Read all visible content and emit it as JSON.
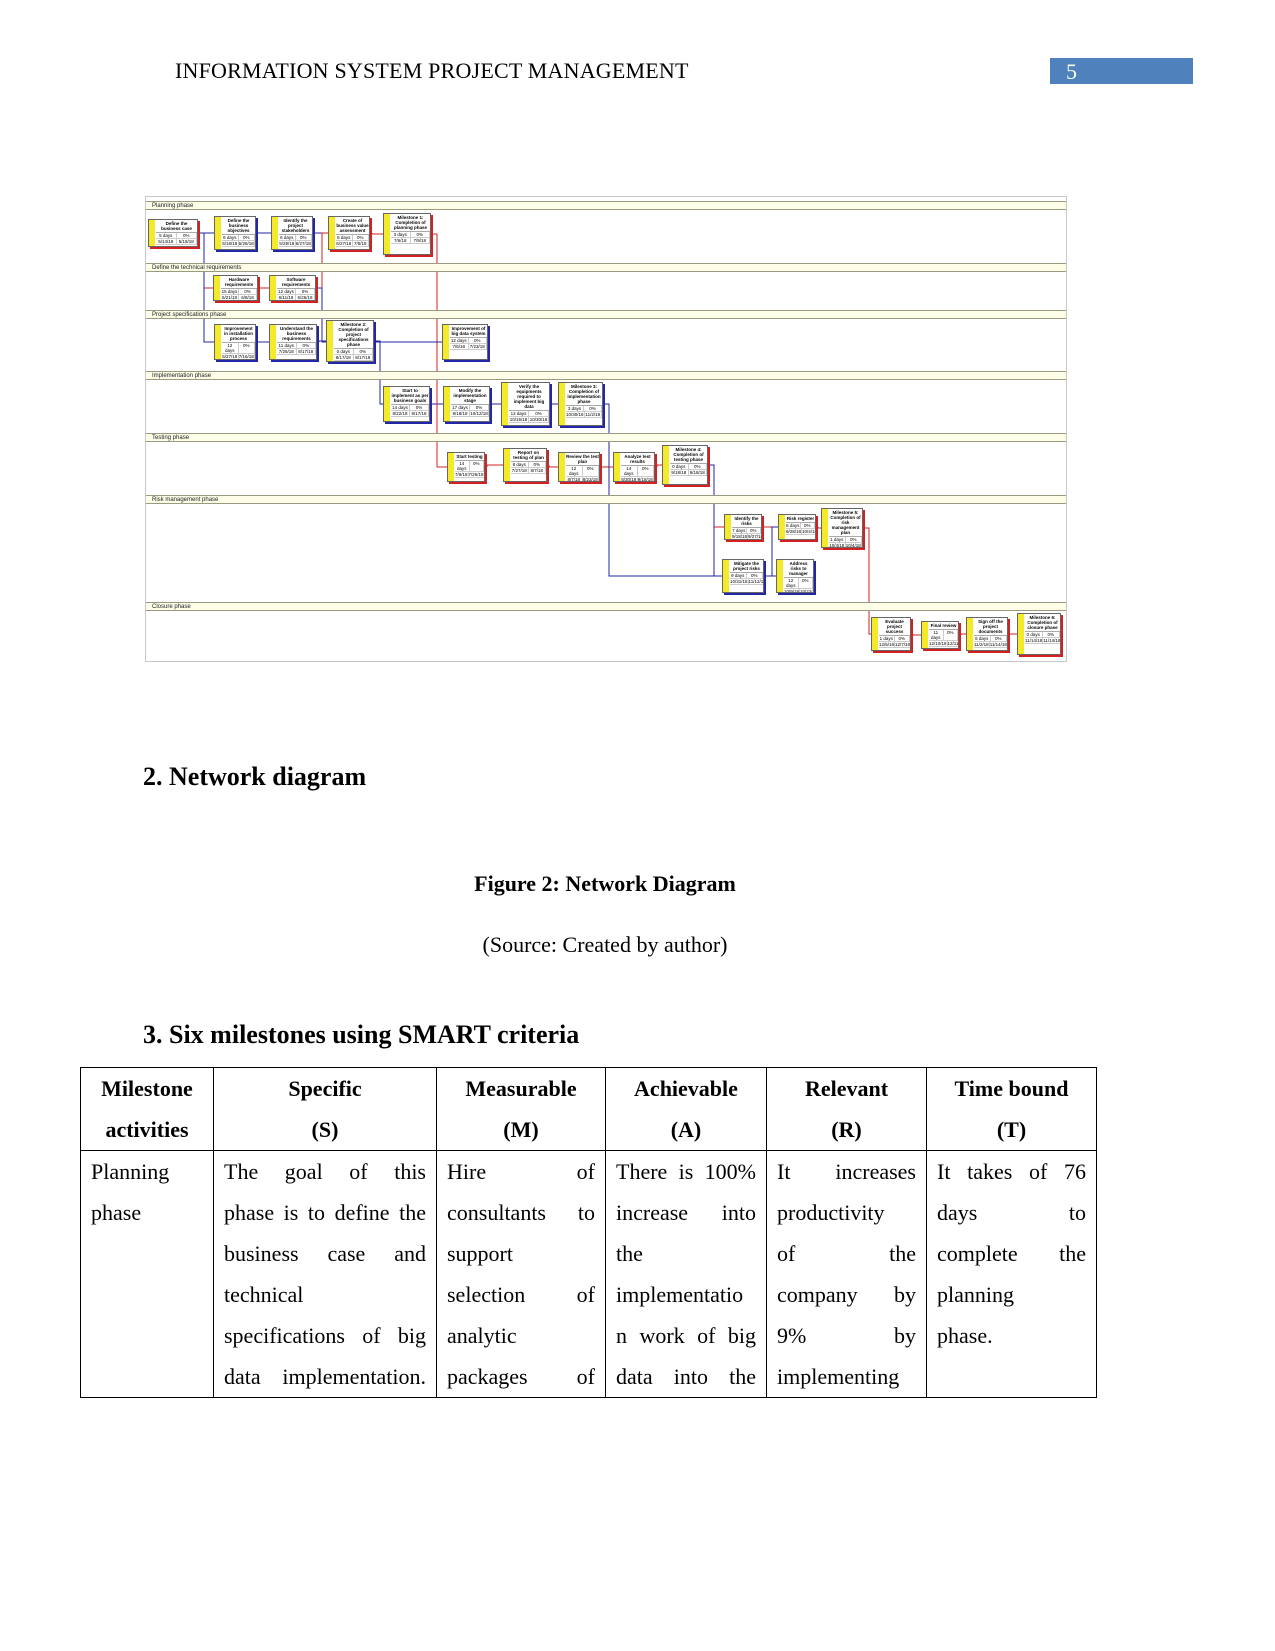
{
  "header": {
    "title": "INFORMATION SYSTEM PROJECT MANAGEMENT",
    "page_number": "5",
    "accent": "#4f81bd"
  },
  "diagram": {
    "lanes": [
      "Planning phase",
      "Define the technical requirements",
      "Project specifications phase",
      "Implementation phase",
      "Testing phase",
      "Risk management phase",
      "Closure phase"
    ],
    "nodes": [
      {
        "title": "Define the business case",
        "duration": "5 days",
        "pct": "0%",
        "start": "5/14/18",
        "finish": "5/18/18",
        "critical": true
      },
      {
        "title": "Define the business objectives",
        "duration": "6 days",
        "pct": "0%",
        "start": "5/18/18",
        "finish": "5/28/18",
        "critical": false
      },
      {
        "title": "Identify the project stakeholders",
        "duration": "6 days",
        "pct": "0%",
        "start": "5/29/18",
        "finish": "6/27/18",
        "critical": false
      },
      {
        "title": "Create of business value assessment",
        "duration": "6 days",
        "pct": "0%",
        "start": "6/27/18",
        "finish": "7/5/18",
        "critical": true
      },
      {
        "title": "Milestone 1: Completion of planning phase",
        "duration": "3 days",
        "pct": "0%",
        "start": "7/6/18",
        "finish": "7/9/18",
        "critical": true
      },
      {
        "title": "Hardware requirements",
        "duration": "15 days",
        "pct": "0%",
        "start": "5/21/18",
        "finish": "6/8/18",
        "critical": true
      },
      {
        "title": "Software requirements",
        "duration": "12 days",
        "pct": "0%",
        "start": "6/11/18",
        "finish": "6/26/18",
        "critical": true
      },
      {
        "title": "Improvement in installation process",
        "duration": "12 days",
        "pct": "0%",
        "start": "6/27/18",
        "finish": "7/16/18",
        "critical": false
      },
      {
        "title": "Understand the business requirements",
        "duration": "11 days",
        "pct": "0%",
        "start": "7/26/18",
        "finish": "8/17/18",
        "critical": false
      },
      {
        "title": "Milestone 2: Completion of project specifications phase",
        "duration": "0 days",
        "pct": "0%",
        "start": "8/17/18",
        "finish": "8/17/18",
        "critical": false
      },
      {
        "title": "Improvement of big data system",
        "duration": "12 days",
        "pct": "0%",
        "start": "7/6/18",
        "finish": "7/23/18",
        "critical": false
      },
      {
        "title": "Start to implement as per business goals",
        "duration": "14 days",
        "pct": "0%",
        "start": "8/22/18",
        "finish": "9/17/18",
        "critical": false
      },
      {
        "title": "Modify the implementation stage",
        "duration": "17 days",
        "pct": "0%",
        "start": "9/18/18",
        "finish": "10/12/18",
        "critical": false
      },
      {
        "title": "Verify the equipments required to implement big data",
        "duration": "12 days",
        "pct": "0%",
        "start": "10/15/18",
        "finish": "10/30/18",
        "critical": false
      },
      {
        "title": "Milestone 3: Completion of implementation phase",
        "duration": "3 days",
        "pct": "0%",
        "start": "10/30/18",
        "finish": "11/2/18",
        "critical": false
      },
      {
        "title": "Start testing",
        "duration": "14 days",
        "pct": "0%",
        "start": "7/9/18",
        "finish": "7/26/18",
        "critical": true
      },
      {
        "title": "Report on testing of plan",
        "duration": "8 days",
        "pct": "0%",
        "start": "7/27/18",
        "finish": "8/7/18",
        "critical": true
      },
      {
        "title": "Review the test plan",
        "duration": "12 days",
        "pct": "0%",
        "start": "8/7/18",
        "finish": "8/23/18",
        "critical": true
      },
      {
        "title": "Analyze test results",
        "duration": "14 days",
        "pct": "0%",
        "start": "8/30/18",
        "finish": "9/18/18",
        "critical": true
      },
      {
        "title": "Milestone 4: Completion of testing phase",
        "duration": "0 days",
        "pct": "0%",
        "start": "9/18/18",
        "finish": "9/18/18",
        "critical": true
      },
      {
        "title": "Identify the risks",
        "duration": "7 days",
        "pct": "0%",
        "start": "9/18/18",
        "finish": "9/27/18",
        "critical": true
      },
      {
        "title": "Risk register",
        "duration": "5 days",
        "pct": "0%",
        "start": "9/28/18",
        "finish": "10/4/18",
        "critical": true
      },
      {
        "title": "Milestone 5: Completion of risk management plan",
        "duration": "1 days",
        "pct": "0%",
        "start": "10/4/18",
        "finish": "10/4/18",
        "critical": true
      },
      {
        "title": "Mitigate the project risks",
        "duration": "9 days",
        "pct": "0%",
        "start": "10/31/18",
        "finish": "11/12/18",
        "critical": false
      },
      {
        "title": "Address risks to manager",
        "duration": "12 days",
        "pct": "0%",
        "start": "10/9/18",
        "finish": "10/22/18",
        "critical": false
      },
      {
        "title": "Evaluate project success",
        "duration": "1 days",
        "pct": "0%",
        "start": "12/5/18",
        "finish": "12/7/18",
        "critical": true
      },
      {
        "title": "Final review",
        "duration": "11 days",
        "pct": "0%",
        "start": "12/10/18",
        "finish": "12/11/18",
        "critical": true
      },
      {
        "title": "Sign off the project documents",
        "duration": "6 days",
        "pct": "0%",
        "start": "11/2/18",
        "finish": "11/14/18",
        "critical": true
      },
      {
        "title": "Milestone 6: Completion of closure phase",
        "duration": "0 days",
        "pct": "0%",
        "start": "11/14/18",
        "finish": "11/14/18",
        "critical": true
      }
    ],
    "colors": {
      "critical": "#d42020",
      "normal": "#2226a8",
      "bar": "#f5ea2a"
    }
  },
  "section2": {
    "heading": "2. Network diagram",
    "caption": "Figure 2: Network Diagram",
    "source": "(Source: Created by author)"
  },
  "section3": {
    "heading": "3. Six milestones using SMART criteria"
  },
  "table": {
    "headers": [
      [
        "Milestone",
        "activities"
      ],
      [
        "Specific",
        "(S)"
      ],
      [
        "Measurable",
        "(M)"
      ],
      [
        "Achievable",
        "(A)"
      ],
      [
        "Relevant",
        "(R)"
      ],
      [
        "Time bound",
        "(T)"
      ]
    ],
    "rows": [
      [
        [
          "Planning",
          "phase"
        ],
        [
          "The goal of this",
          "phase is to define the",
          "business case and",
          "technical",
          "specifications of big",
          "data implementation."
        ],
        [
          "Hire of",
          "consultants to",
          "support",
          "selection of",
          "analytic",
          "packages of"
        ],
        [
          "There is 100%",
          "increase into",
          "the",
          "implementatio",
          "n work of big",
          "data into the"
        ],
        [
          "It increases",
          "productivity",
          "of the",
          "company by",
          "9% by",
          "implementing"
        ],
        [
          "It takes of 76",
          "days to",
          "complete the",
          "planning",
          "phase."
        ]
      ]
    ]
  }
}
